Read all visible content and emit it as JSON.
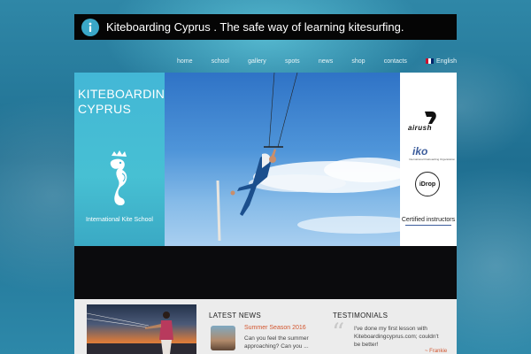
{
  "header": {
    "title": "Kiteboarding Cyprus . The safe way of learning kitesurfing.",
    "logo_icon": "info-icon"
  },
  "nav": {
    "items": [
      "home",
      "school",
      "gallery",
      "spots",
      "news",
      "shop",
      "contacts"
    ],
    "language": "English"
  },
  "hero": {
    "brand_line1": "KITEBOARDING",
    "brand_line2": "CYPRUS",
    "school_label": "International Kite School",
    "sponsors": {
      "airush": "airush",
      "iko": "iko",
      "iko_sub": "International Kiteboarding Organization",
      "idrop": "iDrop"
    },
    "certified": "Certified instructors"
  },
  "news": {
    "title": "LATEST NEWS",
    "headline": "Summer Season 2016",
    "excerpt": "Can you feel the summer approaching? Can you ..."
  },
  "testimonials": {
    "title": "TESTIMONIALS",
    "text": "I've done my first lesson with Kiteboardingcyprus.com; couldn't be better!",
    "author": "Frankie"
  },
  "colors": {
    "accent": "#d2562f",
    "sea": "#2f87a7",
    "panel": "#43b7d6"
  }
}
